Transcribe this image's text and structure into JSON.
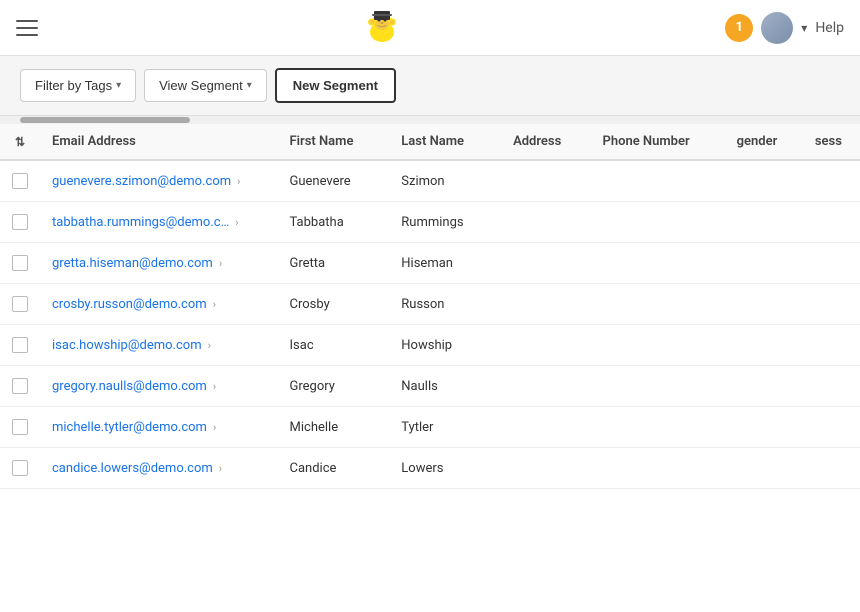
{
  "nav": {
    "help_label": "Help",
    "notification_count": "1"
  },
  "toolbar": {
    "filter_tags_label": "Filter by Tags",
    "view_segment_label": "View Segment",
    "new_segment_label": "New Segment"
  },
  "table": {
    "columns": [
      {
        "id": "email",
        "label": "Email Address"
      },
      {
        "id": "firstname",
        "label": "First Name"
      },
      {
        "id": "lastname",
        "label": "Last Name"
      },
      {
        "id": "address",
        "label": "Address"
      },
      {
        "id": "phone",
        "label": "Phone Number"
      },
      {
        "id": "gender",
        "label": "gender"
      },
      {
        "id": "sess",
        "label": "sess"
      }
    ],
    "rows": [
      {
        "email": "guenevere.szimon@demo.com",
        "firstname": "Guenevere",
        "lastname": "Szimon",
        "address": "",
        "phone": "",
        "gender": "",
        "sess": ""
      },
      {
        "email": "tabbatha.rummings@demo.c…",
        "firstname": "Tabbatha",
        "lastname": "Rummings",
        "address": "",
        "phone": "",
        "gender": "",
        "sess": ""
      },
      {
        "email": "gretta.hiseman@demo.com",
        "firstname": "Gretta",
        "lastname": "Hiseman",
        "address": "",
        "phone": "",
        "gender": "",
        "sess": ""
      },
      {
        "email": "crosby.russon@demo.com",
        "firstname": "Crosby",
        "lastname": "Russon",
        "address": "",
        "phone": "",
        "gender": "",
        "sess": ""
      },
      {
        "email": "isac.howship@demo.com",
        "firstname": "Isac",
        "lastname": "Howship",
        "address": "",
        "phone": "",
        "gender": "",
        "sess": ""
      },
      {
        "email": "gregory.naulls@demo.com",
        "firstname": "Gregory",
        "lastname": "Naulls",
        "address": "",
        "phone": "",
        "gender": "",
        "sess": ""
      },
      {
        "email": "michelle.tytler@demo.com",
        "firstname": "Michelle",
        "lastname": "Tytler",
        "address": "",
        "phone": "",
        "gender": "",
        "sess": ""
      },
      {
        "email": "candice.lowers@demo.com",
        "firstname": "Candice",
        "lastname": "Lowers",
        "address": "",
        "phone": "",
        "gender": "",
        "sess": ""
      }
    ]
  }
}
